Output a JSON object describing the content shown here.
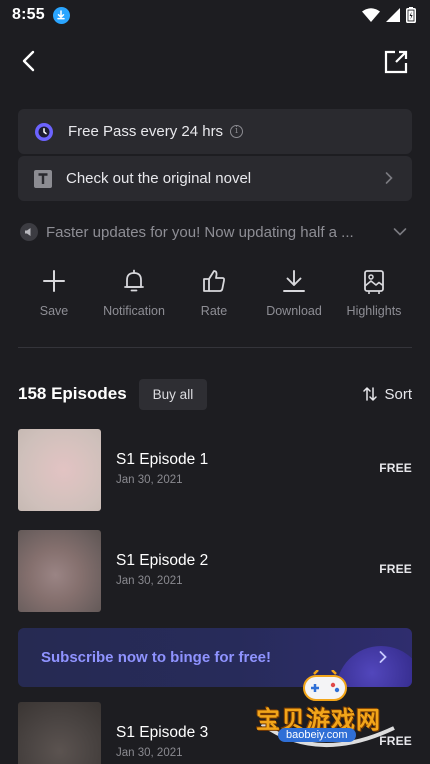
{
  "status_bar": {
    "time": "8:55"
  },
  "free_pass": {
    "label": "Free Pass every 24 hrs",
    "info_glyph": "i"
  },
  "novel": {
    "label": "Check out the original novel",
    "badge": "T"
  },
  "announcement": {
    "text": "Faster updates for you! Now updating half a ..."
  },
  "actions": [
    {
      "label": "Save",
      "icon": "plus-icon"
    },
    {
      "label": "Notification",
      "icon": "bell-icon"
    },
    {
      "label": "Rate",
      "icon": "thumbs-up-icon"
    },
    {
      "label": "Download",
      "icon": "download-icon"
    },
    {
      "label": "Highlights",
      "icon": "image-icon"
    }
  ],
  "episodes_header": {
    "count": "158 Episodes",
    "buy_all": "Buy all",
    "sort": "Sort"
  },
  "episodes": [
    {
      "title": "S1 Episode 1",
      "date": "Jan 30, 2021",
      "price": "FREE"
    },
    {
      "title": "S1 Episode 2",
      "date": "Jan 30, 2021",
      "price": "FREE"
    },
    {
      "title": "S1 Episode 3",
      "date": "Jan 30, 2021",
      "price": "FREE"
    }
  ],
  "subscribe_banner": {
    "text": "Subscribe now to binge for free!"
  },
  "watermark": {
    "title": "宝贝游戏网",
    "url": "baobeiy.com"
  },
  "colors": {
    "background": "#1d1d21",
    "card": "#2a2a2f",
    "accent_purple": "#6c63ff",
    "subscribe_text": "#8f93ff",
    "download_badge": "#2aa5ff"
  }
}
